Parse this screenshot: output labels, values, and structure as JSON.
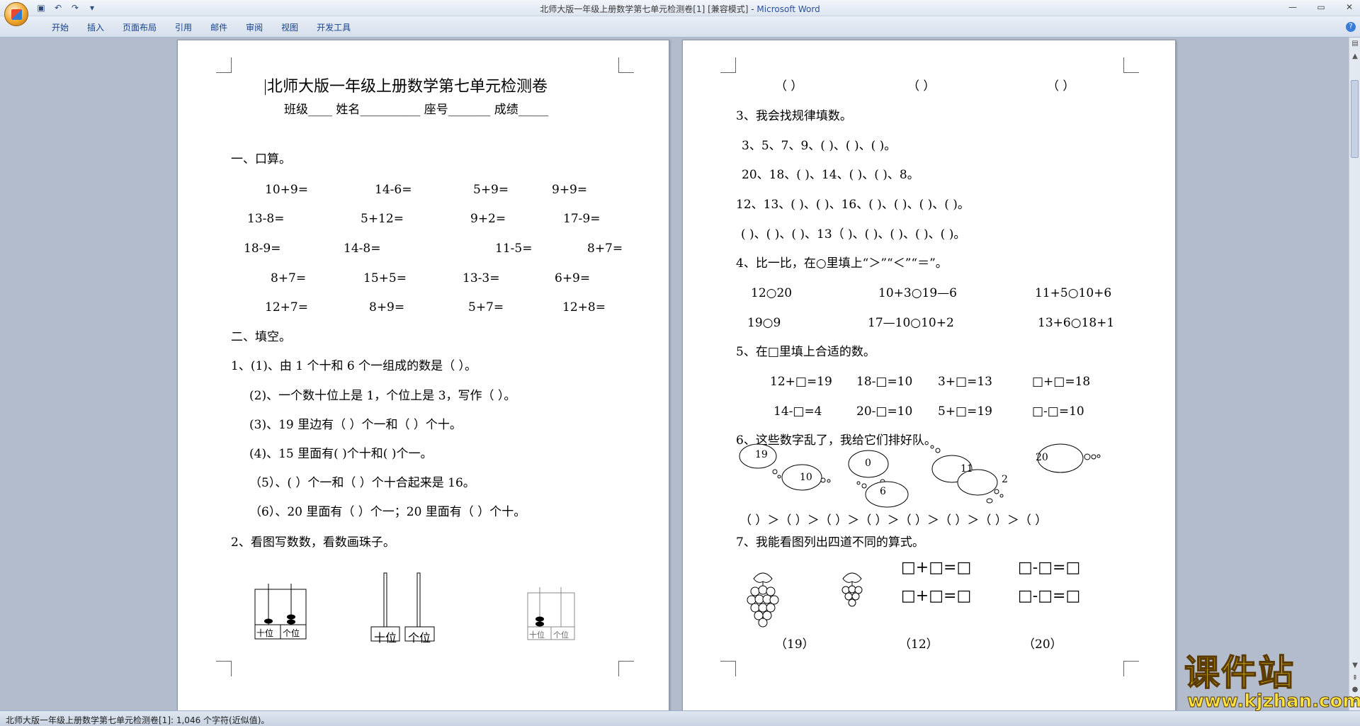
{
  "window": {
    "title_doc": "北师大版一年级上册数学第七单元检测卷[1] [兼容模式] - ",
    "title_app": "Microsoft Word"
  },
  "ribbon": {
    "tabs": [
      "开始",
      "插入",
      "页面布局",
      "引用",
      "邮件",
      "审阅",
      "视图",
      "开发工具"
    ]
  },
  "p1": {
    "title": "北师大版一年级上册数学第七单元检测卷",
    "info": "班级____    姓名__________    座号_______    成绩_____",
    "s1": "一、口算。",
    "calc": [
      [
        "10+9=",
        "14-6=",
        "5+9=",
        "9+9="
      ],
      [
        "13-8=",
        "5+12=",
        "9+2=",
        "17-9="
      ],
      [
        "18-9=",
        "14-8=",
        "11-5=",
        "8+7="
      ],
      [
        "8+7=",
        "15+5=",
        "13-3=",
        "6+9="
      ],
      [
        "12+7=",
        "8+9=",
        "5+7=",
        "12+8="
      ]
    ],
    "s2": "二、填空。",
    "q1": [
      "1、(1)、由 1 个十和 6 个一组成的数是（    ）。",
      "(2)、一个数十位上是 1，个位上是 3，写作（    ）。",
      "(3)、19 里边有（    ）个一和（    ）个十。",
      "(4)、15 里面有(      )个十和(      )个一。",
      "（5）、(      ）个一和（      ）个十合起来是 16。",
      "（6）、20 里面有（   ）个一；20 里面有（  ）个十。"
    ],
    "q2": "2、看图写数数，看数画珠子。",
    "abacus": {
      "tens": "十位",
      "ones": "个位"
    }
  },
  "p2": {
    "blanks": [
      "（      ）",
      "（      ）",
      "（      ）"
    ],
    "q3": "3、我会找规律填数。",
    "q3lines": [
      "3、5、7、9、(    )、(    )、(    )。",
      "20、18、(    )、14、(    )、(    )、8。",
      "12、13、(    )、(    )、16、(    )、(    )、(    )、(    )。",
      "(    )、(    )、(    )、13（    )、(    )、(    )、(    )、(    )。"
    ],
    "q4": "4、比一比，在○里填上“＞”“＜”“＝”。",
    "q4rows": [
      [
        "12○20",
        "10+3○19—6",
        "11+5○10+6"
      ],
      [
        "19○9",
        "17—10○10+2",
        "13+6○18+1"
      ]
    ],
    "q5": "5、在□里填上合适的数。",
    "q5rows": [
      [
        "12+□=19",
        "18-□=10",
        "3+□=13",
        "□+□=18"
      ],
      [
        "14-□=4",
        "20-□=10",
        "5+□=19",
        "□-□=10"
      ]
    ],
    "q6": "6、这些数字乱了，我给它们排好队。",
    "bubbles": [
      "19",
      "10",
      "0",
      "6",
      "11",
      "2",
      "20"
    ],
    "order": "（    ）＞（    ）＞（    ）＞（    ）＞（    ）＞（    ）＞（    ）＞（    ）",
    "q7": "7、我能看图列出四道不同的算式。",
    "eq": [
      "□+□=□",
      "□-□=□",
      "□+□=□",
      "□-□=□"
    ],
    "nums": [
      "（19）",
      "（12）",
      "（20）"
    ]
  },
  "status": {
    "text": "北师大版一年级上册数学第七单元检测卷[1]: 1,046 个字符(近似值)。"
  },
  "watermark": {
    "big": "课件站",
    "small": "www.kjzhan.com"
  }
}
